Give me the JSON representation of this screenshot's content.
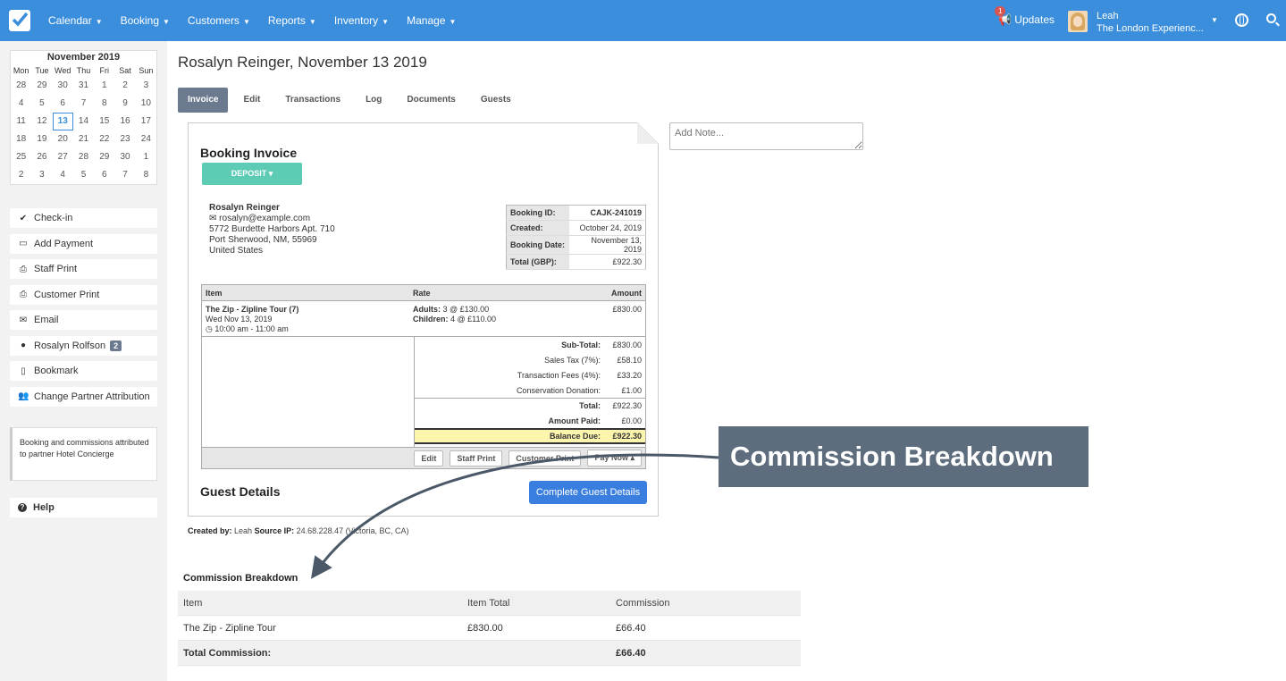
{
  "nav": {
    "menu": [
      {
        "label": "Calendar"
      },
      {
        "label": "Booking"
      },
      {
        "label": "Customers"
      },
      {
        "label": "Reports"
      },
      {
        "label": "Inventory"
      },
      {
        "label": "Manage"
      }
    ],
    "updates_label": "Updates",
    "updates_count": "1",
    "user_name": "Leah",
    "user_company": "The London Experienc...",
    "colors": {
      "bar": "#3a8edc"
    }
  },
  "calendar": {
    "title": "November 2019",
    "dow": [
      "Mon",
      "Tue",
      "Wed",
      "Thu",
      "Fri",
      "Sat",
      "Sun"
    ],
    "days": [
      "28",
      "29",
      "30",
      "31",
      "1",
      "2",
      "3",
      "4",
      "5",
      "6",
      "7",
      "8",
      "9",
      "10",
      "11",
      "12",
      "13",
      "14",
      "15",
      "16",
      "17",
      "18",
      "19",
      "20",
      "21",
      "22",
      "23",
      "24",
      "25",
      "26",
      "27",
      "28",
      "29",
      "30",
      "1",
      "2",
      "3",
      "4",
      "5",
      "6",
      "7",
      "8"
    ],
    "today": "13"
  },
  "sidebar": {
    "actions": [
      {
        "label": "Check-in",
        "icon": "check-icon"
      },
      {
        "label": "Add Payment",
        "icon": "credit-card-icon"
      },
      {
        "label": "Staff Print",
        "icon": "print-icon"
      },
      {
        "label": "Customer Print",
        "icon": "print-icon"
      },
      {
        "label": "Email",
        "icon": "envelope-icon"
      },
      {
        "label": "Rosalyn Rolfson",
        "icon": "user-icon",
        "count": "2"
      },
      {
        "label": "Bookmark",
        "icon": "bookmark-icon"
      },
      {
        "label": "Change Partner Attribution",
        "icon": "users-icon"
      }
    ],
    "note": "Booking and commissions attributed to partner Hotel Concierge",
    "help": "Help"
  },
  "page": {
    "title": "Rosalyn Reinger, November 13 2019",
    "tabs": [
      "Invoice",
      "Edit",
      "Transactions",
      "Log",
      "Documents",
      "Guests"
    ],
    "active_tab": "Invoice"
  },
  "invoice": {
    "title": "Booking Invoice",
    "deposit_label": "DEPOSIT",
    "customer": {
      "name": "Rosalyn Reinger",
      "email": "rosalyn@example.com",
      "address1": "5772 Burdette Harbors Apt. 710",
      "address2": "Port Sherwood, NM, 55969",
      "country": "United States"
    },
    "meta": [
      {
        "k": "Booking ID:",
        "v": "CAJK-241019"
      },
      {
        "k": "Created:",
        "v": "October 24, 2019"
      },
      {
        "k": "Booking Date:",
        "v": "November 13, 2019"
      },
      {
        "k": "Total (GBP):",
        "v": "£922.30"
      }
    ],
    "columns": {
      "item": "Item",
      "rate": "Rate",
      "amount": "Amount"
    },
    "line": {
      "name": "The Zip - Zipline Tour (7)",
      "date": "Wed Nov 13, 2019",
      "time": "10:00 am - 11:00 am",
      "adults_label": "Adults:",
      "adults": "3 @ £130.00",
      "children_label": "Children:",
      "children": "4 @ £110.00",
      "amount": "£830.00"
    },
    "totals": {
      "subtotal_label": "Sub-Total:",
      "subtotal": "£830.00",
      "tax_label": "Sales Tax (7%):",
      "tax": "£58.10",
      "fees_label": "Transaction Fees (4%):",
      "fees": "£33.20",
      "donation_label": "Conservation Donation:",
      "donation": "£1.00",
      "total_label": "Total:",
      "total": "£922.30",
      "paid_label": "Amount Paid:",
      "paid": "£0.00",
      "balance_label": "Balance Due:",
      "balance": "£922.30"
    },
    "buttons": {
      "edit": "Edit",
      "staff_print": "Staff Print",
      "customer_print": "Customer Print",
      "pay_now": "Pay Now"
    },
    "guest_title": "Guest Details",
    "guest_button": "Complete Guest Details"
  },
  "created_by": {
    "label": "Created by:",
    "user": "Leah",
    "ip_label": "Source IP:",
    "ip": "24.68.228.47 (Victoria, BC, CA)"
  },
  "note_placeholder": "Add Note...",
  "commission": {
    "title": "Commission Breakdown",
    "headers": [
      "Item",
      "Item Total",
      "Commission"
    ],
    "rows": [
      {
        "item": "The Zip - Zipline Tour",
        "total": "£830.00",
        "commission": "£66.40"
      }
    ],
    "total_label": "Total Commission:",
    "total_value": "£66.40"
  },
  "callout": "Commission Breakdown"
}
